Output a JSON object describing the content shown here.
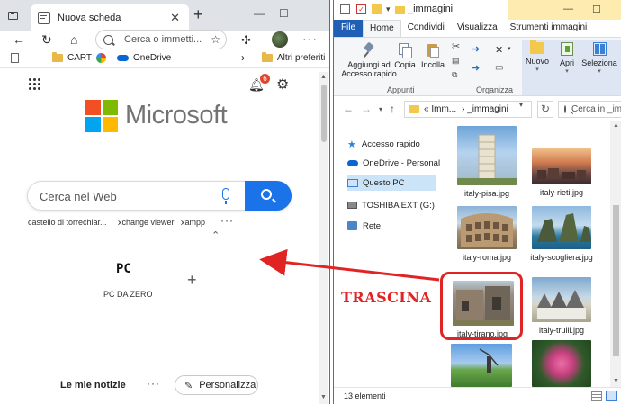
{
  "edge": {
    "tab_title": "Nuova scheda",
    "tab_close": "✕",
    "new_tab": "+",
    "win_min": "—",
    "win_max": "☐",
    "address_placeholder": "Cerca o immetti...",
    "favorites": [
      {
        "label": "CART",
        "icon": "folder-icon"
      },
      {
        "label": "OneDrive",
        "icon": "cloud-icon"
      },
      {
        "label": "Altri preferiti",
        "icon": "folder-icon"
      }
    ],
    "notifications_count": "6",
    "brand": "Microsoft",
    "brand_colors": [
      "#f25022",
      "#7fba00",
      "#00a4ef",
      "#ffb900"
    ],
    "search_placeholder": "Cerca nel Web",
    "suggestions": [
      "castello di torrechiar...",
      "xchange viewer",
      "xampp"
    ],
    "quick_link_tile": "PC",
    "quick_link_label": "PC DA ZERO",
    "news_title": "Le mie notizie",
    "personalize_label": "Personalizza",
    "accent": "#1a73e8"
  },
  "annotation": {
    "label": "TRASCINA",
    "color": "#e02424"
  },
  "explorer": {
    "window_title": "_immagini",
    "win_min": "—",
    "win_max": "☐",
    "ribbon_tabs": [
      "File",
      "Home",
      "Condividi",
      "Visualizza",
      "Strumenti immagini"
    ],
    "ribbon": {
      "pin_label_1": "Aggiungi ad",
      "pin_label_2": "Accesso rapido",
      "copy": "Copia",
      "paste": "Incolla",
      "group_clipboard": "Appunti",
      "group_organize": "Organizza",
      "new": "Nuovo",
      "open": "Apri",
      "select": "Seleziona"
    },
    "path_1": "«  Imm...",
    "path_2": "›   _immagini",
    "search_placeholder": "Cerca in _immagini",
    "nav": [
      {
        "label": "Accesso rapido",
        "icon": "star-icon"
      },
      {
        "label": "OneDrive - Personal",
        "icon": "onedrive-icon"
      },
      {
        "label": "Questo PC",
        "icon": "pc-icon"
      },
      {
        "label": "TOSHIBA EXT (G:)",
        "icon": "drive-icon"
      },
      {
        "label": "Rete",
        "icon": "network-icon"
      }
    ],
    "files": [
      {
        "name": "italy-pisa.jpg"
      },
      {
        "name": "italy-rieti.jpg"
      },
      {
        "name": "italy-roma.jpg"
      },
      {
        "name": "italy-scogliera.jpg"
      },
      {
        "name": "italy-tirano.jpg"
      },
      {
        "name": "italy-trulli.jpg"
      },
      {
        "name": ""
      },
      {
        "name": ""
      }
    ],
    "item_count": "13 elementi",
    "selection_color": "#cce4f7"
  }
}
